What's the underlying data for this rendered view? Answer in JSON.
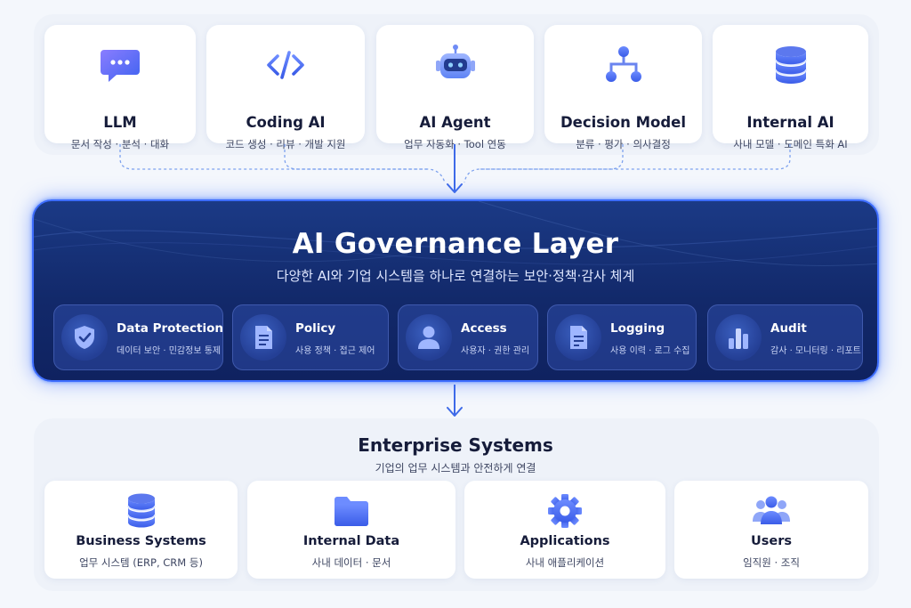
{
  "colors": {
    "accent": "#3d6dff",
    "governance_bg": "#132b6e",
    "icon_gradient_start": "#8a7dff",
    "icon_gradient_end": "#3f63f0"
  },
  "ai_sources": [
    {
      "icon": "chat-bubble-icon",
      "title": "LLM",
      "subtitle": "문서 작성 · 분석 · 대화"
    },
    {
      "icon": "code-icon",
      "title": "Coding AI",
      "subtitle": "코드 생성 · 리뷰 · 개발 지원"
    },
    {
      "icon": "robot-icon",
      "title": "AI Agent",
      "subtitle": "업무 자동화 · Tool 연동"
    },
    {
      "icon": "hierarchy-icon",
      "title": "Decision Model",
      "subtitle": "분류 · 평가 · 의사결정"
    },
    {
      "icon": "database-icon",
      "title": "Internal AI",
      "subtitle": "사내 모델 · 도메인 특화 AI"
    }
  ],
  "governance": {
    "title": "AI Governance Layer",
    "subtitle": "다양한 AI와 기업 시스템을 하나로 연결하는 보안·정책·감사 체계",
    "modules": [
      {
        "icon": "shield-icon",
        "title": "Data Protection",
        "subtitle": "데이터 보안 · 민감정보 통제"
      },
      {
        "icon": "document-icon",
        "title": "Policy",
        "subtitle": "사용 정책 · 접근 제어"
      },
      {
        "icon": "user-icon",
        "title": "Access",
        "subtitle": "사용자 · 권한 관리"
      },
      {
        "icon": "log-document-icon",
        "title": "Logging",
        "subtitle": "사용 이력 · 로그 수집"
      },
      {
        "icon": "bar-chart-icon",
        "title": "Audit",
        "subtitle": "감사 · 모니터링 · 리포트"
      }
    ]
  },
  "enterprise": {
    "title": "Enterprise Systems",
    "subtitle": "기업의 업무 시스템과 안전하게 연결",
    "systems": [
      {
        "icon": "database-icon",
        "title": "Business Systems",
        "subtitle": "업무 시스템 (ERP, CRM 등)"
      },
      {
        "icon": "folder-icon",
        "title": "Internal Data",
        "subtitle": "사내 데이터 · 문서"
      },
      {
        "icon": "gear-icon",
        "title": "Applications",
        "subtitle": "사내 애플리케이션"
      },
      {
        "icon": "users-icon",
        "title": "Users",
        "subtitle": "임직원 · 조직"
      }
    ]
  }
}
